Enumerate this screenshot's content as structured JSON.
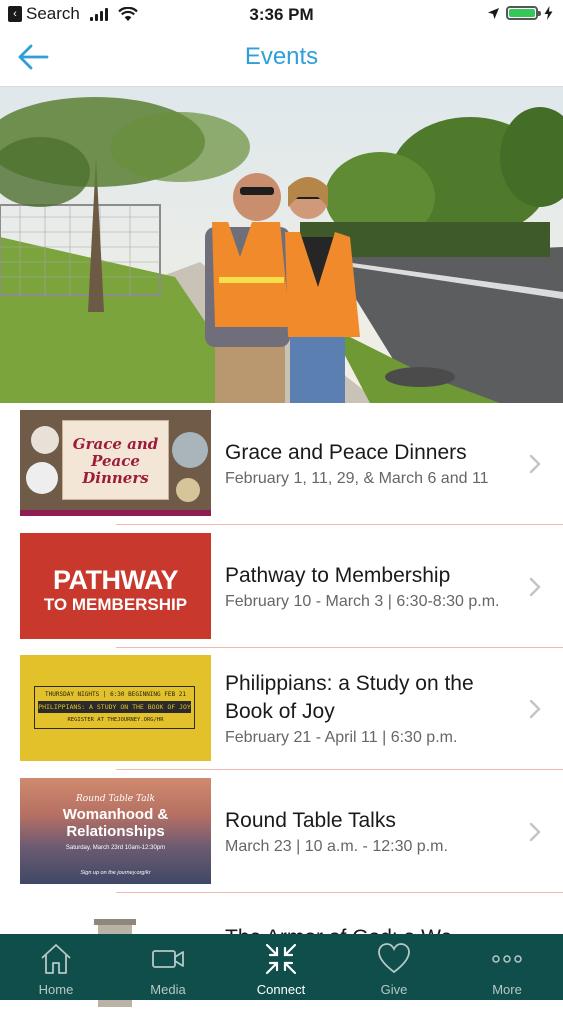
{
  "status_bar": {
    "back_app": "Search",
    "time": "3:36 PM"
  },
  "nav": {
    "title": "Events",
    "back_icon": "arrow-left-icon"
  },
  "colors": {
    "accent": "#2f9fd8",
    "tabbar_bg": "#0f4e4b",
    "divider": "#f0b8ad"
  },
  "events": [
    {
      "title": "Grace and Peace Dinners",
      "date": "February 1, 11, 29, & March 6 and 11",
      "thumb_text": "Grace and Peace Dinners"
    },
    {
      "title": "Pathway to Membership",
      "date": "February 10 - March 3 | 6:30-8:30 p.m.",
      "thumb_big": "PATHWAY",
      "thumb_small": "TO MEMBERSHIP"
    },
    {
      "title": "Philippians: a Study on the Book of Joy",
      "date": "February 21 - April 11 | 6:30 p.m.",
      "thumb_line1": "THURSDAY NIGHTS | 6:30 BEGINNING FEB 21",
      "thumb_line2": "PHILIPPIANS: A STUDY ON THE BOOK OF JOY",
      "thumb_line3": "REGISTER AT THEJOURNEY.ORG/HR"
    },
    {
      "title": "Round Table Talks",
      "date": "March 23 | 10 a.m. - 12:30 p.m.",
      "thumb_a": "Round Table Talk",
      "thumb_b": "Womanhood & Relationships",
      "thumb_c": "Saturday, March 23rd 10am-12:30pm",
      "thumb_d": "Sign up on the journey.org/kr"
    },
    {
      "title": "The Armor of God: a We"
    }
  ],
  "tabs": [
    {
      "label": "Home",
      "icon": "home-icon"
    },
    {
      "label": "Media",
      "icon": "video-camera-icon"
    },
    {
      "label": "Connect",
      "icon": "connect-arrows-icon",
      "active": true
    },
    {
      "label": "Give",
      "icon": "heart-icon"
    },
    {
      "label": "More",
      "icon": "more-dots-icon"
    }
  ]
}
